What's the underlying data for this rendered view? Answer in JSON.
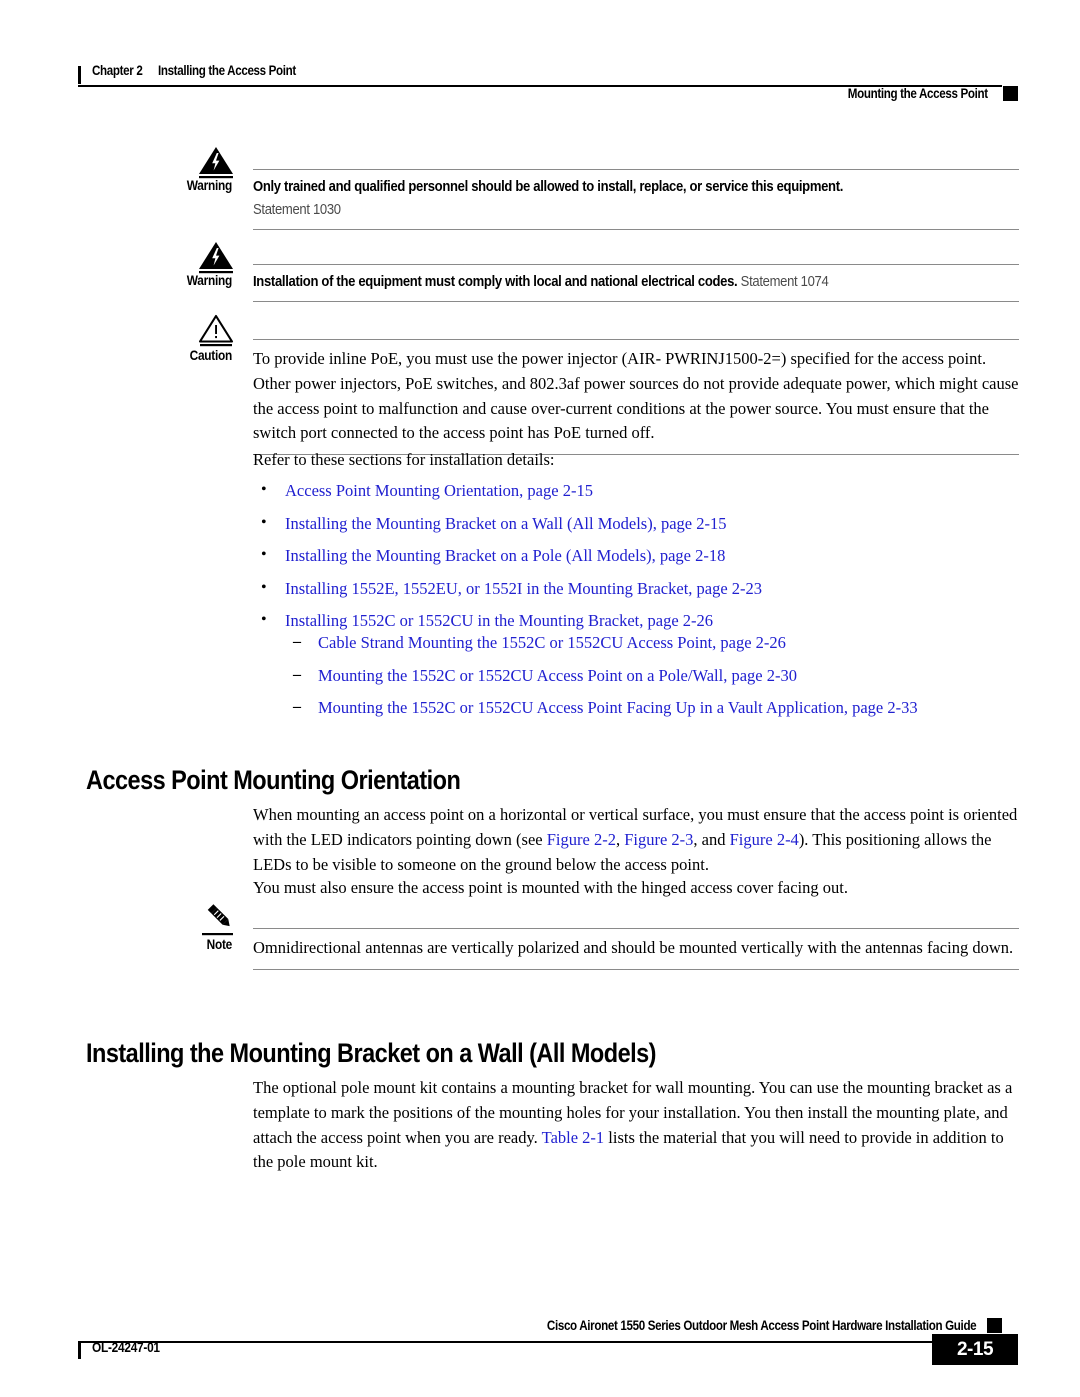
{
  "header": {
    "chapter": "Chapter 2",
    "chapter_title": "Installing the Access Point",
    "running_head": "Mounting the Access Point"
  },
  "warnings": [
    {
      "label": "Warning",
      "icon": "warning-lightning-triangle-icon",
      "text": "Only trained and qualified personnel should be allowed to install, replace, or service this equipment.",
      "statement": "Statement 1030",
      "statement_inline": false
    },
    {
      "label": "Warning",
      "icon": "warning-lightning-triangle-icon",
      "text": "Installation of the equipment must comply with local and national electrical codes.",
      "statement": "Statement 1074",
      "statement_inline": true
    }
  ],
  "caution": {
    "label": "Caution",
    "icon": "caution-exclamation-triangle-icon",
    "text": "To provide inline PoE, you must use the power injector (AIR- PWRINJ1500-2=) specified for the access point. Other power injectors, PoE switches, and 802.3af power sources do not provide adequate power, which might cause the access point to malfunction and cause over-current conditions at the power source. You must ensure that the switch port connected to the access point has PoE turned off."
  },
  "intro": {
    "lead_in": "Refer to these sections for installation details:"
  },
  "bullets": [
    "Access Point Mounting Orientation, page 2-15",
    "Installing the Mounting Bracket on a Wall (All Models), page 2-15",
    "Installing the Mounting Bracket on a Pole (All Models), page 2-18",
    "Installing 1552E, 1552EU, or 1552I in the Mounting Bracket, page 2-23",
    "Installing 1552C or 1552CU in the Mounting Bracket, page 2-26"
  ],
  "sub_bullets": [
    "Cable Strand Mounting the 1552C or 1552CU Access Point, page 2-26",
    "Mounting the 1552C or 1552CU Access Point on a Pole/Wall, page 2-30",
    "Mounting the 1552C or 1552CU Access Point Facing Up in a Vault Application, page 2-33"
  ],
  "section1": {
    "heading": "Access Point Mounting Orientation",
    "para1_a": "When mounting an access point on a horizontal or vertical surface, you must ensure that the access point is oriented with the LED indicators pointing down (see ",
    "link_fig1": "Figure 2-2",
    "para1_b": ", ",
    "link_fig2": "Figure 2-3",
    "para1_c": ", and ",
    "link_fig3": "Figure 2-4",
    "para1_d": "). This positioning allows the LEDs to be visible to someone on the ground below the access point.",
    "para2": "You must also ensure the access point is mounted with the hinged access cover facing out."
  },
  "note": {
    "label": "Note",
    "icon": "note-pencil-icon",
    "text": "Omnidirectional antennas are vertically polarized and should be mounted vertically with the antennas facing down."
  },
  "section2": {
    "heading": "Installing the Mounting Bracket on a Wall (All Models)",
    "para_a": "The optional pole mount kit contains a mounting bracket for wall mounting. You can use the mounting bracket as a template to mark the positions of the mounting holes for your installation. You then install the mounting plate, and attach the access point when you are ready. ",
    "link_table": "Table 2-1",
    "para_b": " lists the material that you will need to provide in addition to the pole mount kit."
  },
  "footer": {
    "doc_id": "OL-24247-01",
    "guide_title": "Cisco Aironet 1550 Series Outdoor Mesh Access Point Hardware Installation Guide",
    "page_number": "2-15"
  },
  "colors": {
    "link": "#2020d0",
    "rule": "#8a8a8a",
    "text": "#000000"
  }
}
